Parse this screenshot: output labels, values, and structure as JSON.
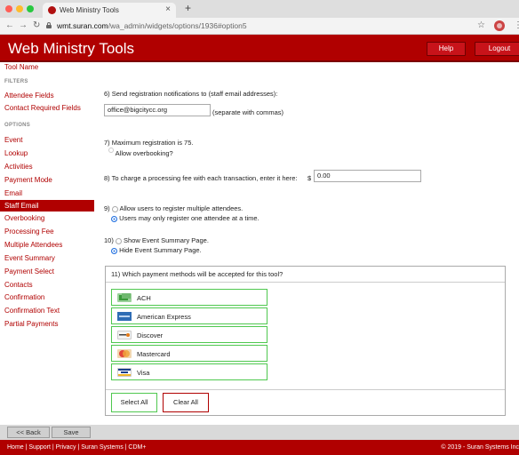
{
  "browser": {
    "tab_title": "Web Ministry Tools",
    "url_host": "wmt.suran.com",
    "url_path": "/wa_admin/widgets/options/1936#option5"
  },
  "header": {
    "title": "Web Ministry Tools",
    "help_label": "Help",
    "logout_label": "Logout"
  },
  "sidebar": {
    "tool_name": "Tool Name",
    "filters_heading": "FILTERS",
    "filters": [
      "Attendee Fields",
      "Contact Required Fields"
    ],
    "options_heading": "OPTIONS",
    "options": [
      "Event",
      "Lookup",
      "Activities",
      "Payment Mode",
      "Email",
      "Staff Email",
      "Overbooking",
      "Processing Fee",
      "Multiple Attendees",
      "Event Summary",
      "Payment Select",
      "Contacts",
      "Confirmation",
      "Confirmation Text",
      "Partial Payments"
    ],
    "active_item": "Staff Email"
  },
  "main": {
    "q6": {
      "label": "6) Send registration notifications to (staff email addresses):",
      "value": "office@bigcitycc.org",
      "hint": "(separate with commas)"
    },
    "q7": {
      "label": "7) Maximum registration is 75.",
      "option": "Allow overbooking?"
    },
    "q8": {
      "label": "8) To charge a processing fee with each transaction, enter it here:",
      "currency": "$",
      "value": "0.00"
    },
    "q9": {
      "number": "9)",
      "options": [
        "Allow users to register multiple attendees.",
        "Users may only register one attendee at a time."
      ],
      "selected": 1
    },
    "q10": {
      "number": "10)",
      "options": [
        "Show Event Summary Page.",
        "Hide Event Summary Page."
      ],
      "selected": 1
    },
    "q11": {
      "label": "11) Which payment methods will be accepted for this tool?",
      "methods": [
        {
          "label": "ACH",
          "icon": "bank-transfer-icon",
          "color": "#3a9a3a"
        },
        {
          "label": "American Express",
          "icon": "amex-card-icon",
          "color": "#2f6db5"
        },
        {
          "label": "Discover",
          "icon": "discover-card-icon",
          "color": "#e57b19"
        },
        {
          "label": "Mastercard",
          "icon": "mastercard-icon",
          "color": "#e2473a"
        },
        {
          "label": "Visa",
          "icon": "visa-card-icon",
          "color": "#1a3e8c"
        }
      ],
      "select_all_label": "Select All",
      "clear_all_label": "Clear All"
    }
  },
  "bottom_bar": {
    "back_label": "<< Back",
    "save_label": "Save"
  },
  "footer": {
    "links": "Home | Support | Privacy | Suran Systems | CDM+",
    "copyright": "© 2019 - Suran Systems Inc"
  },
  "colors": {
    "brand_red": "#b00000",
    "accent_green": "#4fc84f",
    "radio_blue": "#1f6fe0"
  }
}
